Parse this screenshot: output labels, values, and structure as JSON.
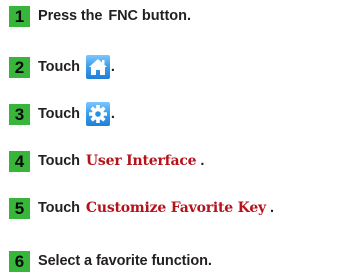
{
  "steps": [
    {
      "number": "1",
      "text": "Press the",
      "key": "FNC",
      "suffix": " button."
    },
    {
      "number": "2",
      "text": "Touch",
      "icon": "home-icon",
      "suffix": "."
    },
    {
      "number": "3",
      "text": "Touch",
      "icon": "gear-icon",
      "suffix": "."
    },
    {
      "number": "4",
      "text": "Touch",
      "ui_label": "User Interface",
      "suffix": "."
    },
    {
      "number": "5",
      "text": "Touch",
      "ui_label": "Customize Favorite Key",
      "suffix": "."
    },
    {
      "number": "6",
      "text": "Select a favorite function."
    }
  ],
  "colors": {
    "step_badge": "#38b63c",
    "ui_label": "#b5121b",
    "icon_bg": "#2a8fe3"
  }
}
